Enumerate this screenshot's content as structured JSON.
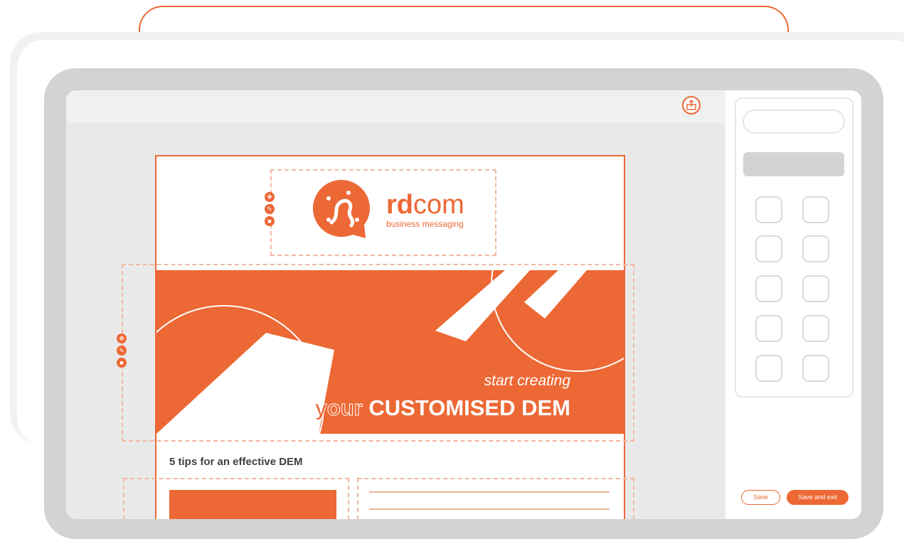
{
  "toolbar": {
    "upload_icon": "upload-icon"
  },
  "email": {
    "brand_prefix": "rd",
    "brand_suffix": "com",
    "brand_tagline": "business messaging",
    "hero_subtitle": "start creating",
    "hero_accent": "your",
    "hero_title": "CUSTOMISED DEM",
    "article_title": "5 tips for an effective DEM"
  },
  "sidebar": {
    "save_label": "Save",
    "save_exit_label": "Save and exit"
  },
  "block_tools": [
    "move-icon",
    "edit-icon",
    "delete-icon"
  ],
  "colors": {
    "accent": "#ec6834",
    "dashed_outline": "#f4b7a0",
    "frame_gray": "#d3d3d3"
  }
}
